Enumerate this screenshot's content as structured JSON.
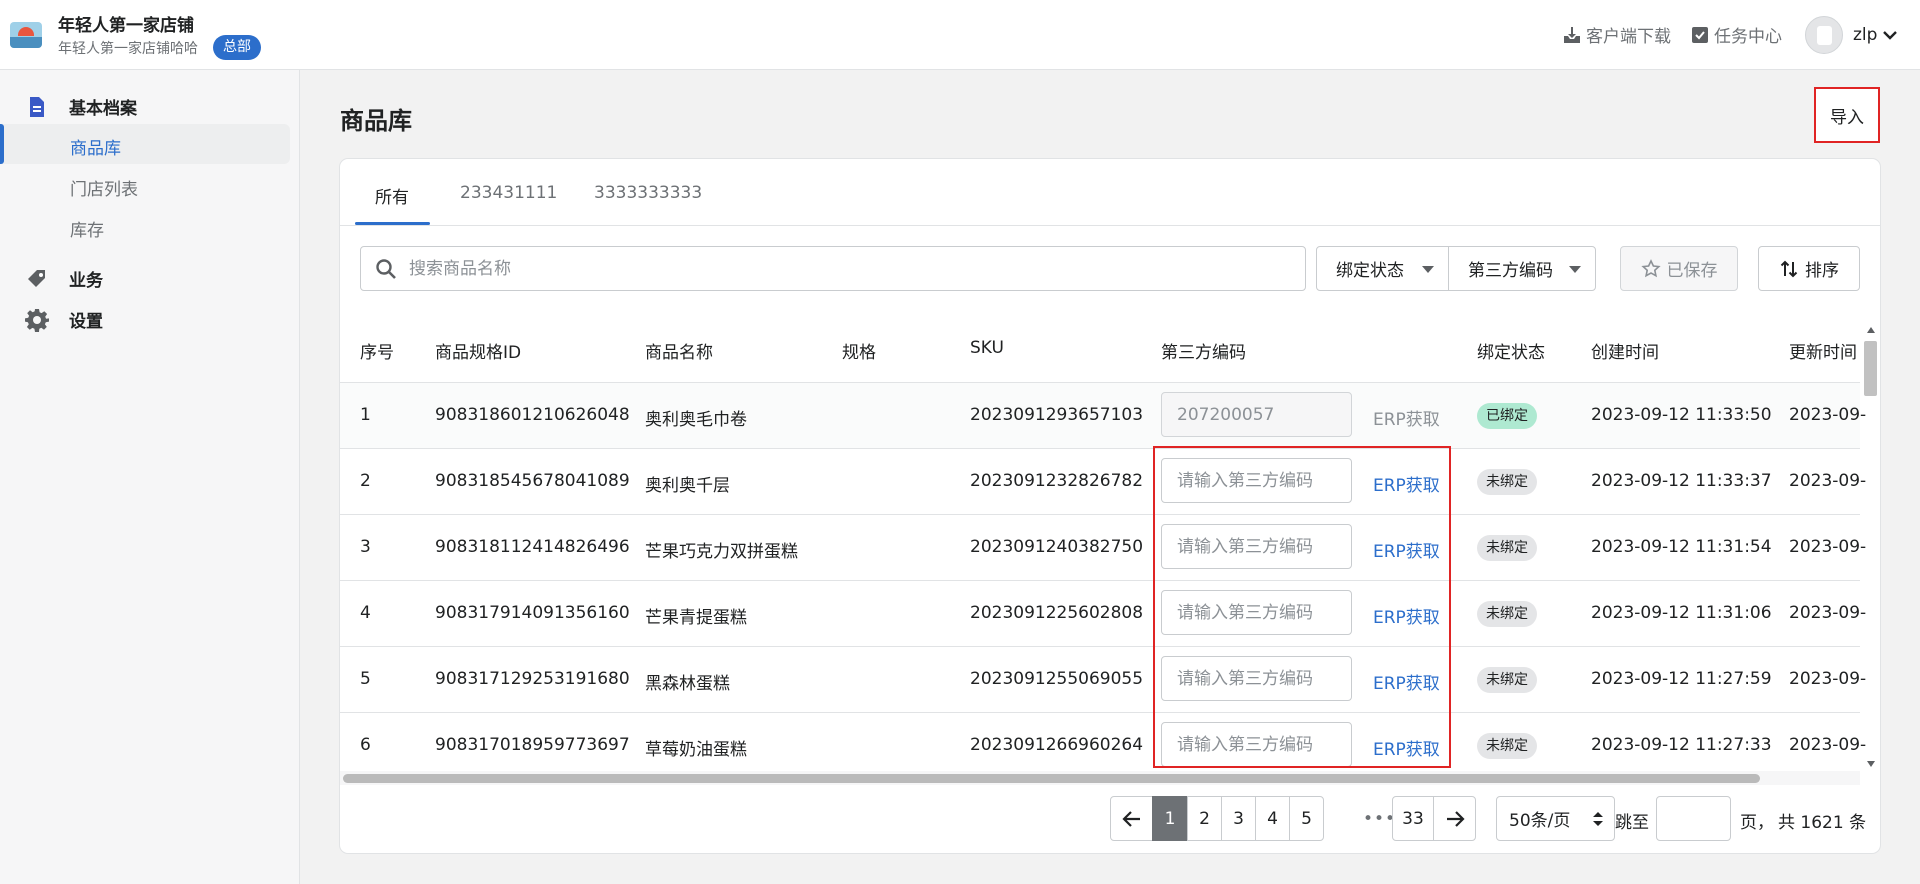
{
  "header": {
    "shop_name": "年轻人第一家店铺",
    "shop_sub": "年轻人第一家店铺哈哈",
    "hq_badge": "总部",
    "download": "客户端下载",
    "tasks": "任务中心",
    "user": "zlp"
  },
  "sidebar": {
    "groups": [
      {
        "label": "基本档案",
        "icon": "document-icon",
        "items": [
          "商品库",
          "门店列表",
          "库存"
        ]
      },
      {
        "label": "业务",
        "icon": "tag-icon"
      },
      {
        "label": "设置",
        "icon": "gear-icon"
      }
    ],
    "active_item": "商品库"
  },
  "page": {
    "title": "商品库",
    "import_button": "导入"
  },
  "tabs": [
    "所有",
    "233431111",
    "3333333333"
  ],
  "toolbar": {
    "search_placeholder": "搜索商品名称",
    "filter_bind_status": "绑定状态",
    "filter_third_code": "第三方编码",
    "saved_button": "已保存",
    "sort_button": "排序"
  },
  "table": {
    "columns": [
      "序号",
      "商品规格ID",
      "商品名称",
      "规格",
      "SKU",
      "第三方编码",
      "绑定状态",
      "创建时间",
      "更新时间"
    ],
    "code_placeholder": "请输入第三方编码",
    "erp_label": "ERP获取",
    "rows": [
      {
        "no": "1",
        "spec_id": "908318601210626048",
        "name": "奥利奥毛巾卷",
        "spec": "",
        "sku": "2023091293657103",
        "third_code": "207200057",
        "status": "已绑定",
        "created": "2023-09-12 11:33:50",
        "updated": "2023-09-"
      },
      {
        "no": "2",
        "spec_id": "908318545678041089",
        "name": "奥利奥千层",
        "spec": "",
        "sku": "2023091232826782",
        "third_code": "",
        "status": "未绑定",
        "created": "2023-09-12 11:33:37",
        "updated": "2023-09-"
      },
      {
        "no": "3",
        "spec_id": "908318112414826496",
        "name": "芒果巧克力双拼蛋糕",
        "spec": "",
        "sku": "2023091240382750",
        "third_code": "",
        "status": "未绑定",
        "created": "2023-09-12 11:31:54",
        "updated": "2023-09-"
      },
      {
        "no": "4",
        "spec_id": "908317914091356160",
        "name": "芒果青提蛋糕",
        "spec": "",
        "sku": "2023091225602808",
        "third_code": "",
        "status": "未绑定",
        "created": "2023-09-12 11:31:06",
        "updated": "2023-09-"
      },
      {
        "no": "5",
        "spec_id": "908317129253191680",
        "name": "黑森林蛋糕",
        "spec": "",
        "sku": "2023091255069055",
        "third_code": "",
        "status": "未绑定",
        "created": "2023-09-12 11:27:59",
        "updated": "2023-09-"
      },
      {
        "no": "6",
        "spec_id": "908317018959773697",
        "name": "草莓奶油蛋糕",
        "spec": "",
        "sku": "2023091266960264",
        "third_code": "",
        "status": "未绑定",
        "created": "2023-09-12 11:27:33",
        "updated": "2023-09-"
      }
    ]
  },
  "pagination": {
    "pages": [
      "1",
      "2",
      "3",
      "4",
      "5"
    ],
    "ellipsis": "•••",
    "last_page": "33",
    "current": "1",
    "per_page": "50条/页",
    "jump_prefix": "跳至",
    "jump_suffix": "页，",
    "total": "共 1621 条"
  },
  "colors": {
    "accent": "#2c6ecb",
    "bound_badge": "#aee9d1",
    "unbound_badge": "#e4e5e7",
    "highlight": "#e02424"
  }
}
